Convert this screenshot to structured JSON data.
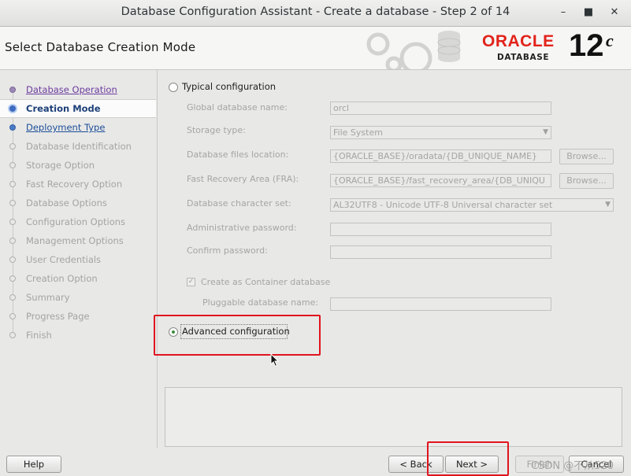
{
  "window": {
    "title": "Database Configuration Assistant - Create a database - Step 2 of 14"
  },
  "header": {
    "heading": "Select Database Creation Mode",
    "logo_brand": "ORACLE",
    "logo_product": "DATABASE",
    "logo_version": "12",
    "logo_version_suffix": "c"
  },
  "steps": [
    {
      "label": "Database Operation",
      "state": "done"
    },
    {
      "label": "Creation Mode",
      "state": "current"
    },
    {
      "label": "Deployment Type",
      "state": "link"
    },
    {
      "label": "Database Identification",
      "state": "disabled"
    },
    {
      "label": "Storage Option",
      "state": "disabled"
    },
    {
      "label": "Fast Recovery Option",
      "state": "disabled"
    },
    {
      "label": "Database Options",
      "state": "disabled"
    },
    {
      "label": "Configuration Options",
      "state": "disabled"
    },
    {
      "label": "Management Options",
      "state": "disabled"
    },
    {
      "label": "User Credentials",
      "state": "disabled"
    },
    {
      "label": "Creation Option",
      "state": "disabled"
    },
    {
      "label": "Summary",
      "state": "disabled"
    },
    {
      "label": "Progress Page",
      "state": "disabled"
    },
    {
      "label": "Finish",
      "state": "disabled"
    }
  ],
  "typical": {
    "label": "Typical configuration",
    "selected": false,
    "global_db_name_label": "Global database name:",
    "global_db_name_value": "orcl",
    "storage_type_label": "Storage type:",
    "storage_type_value": "File System",
    "db_files_location_label": "Database files location:",
    "db_files_location_value": "{ORACLE_BASE}/oradata/{DB_UNIQUE_NAME}",
    "fra_label": "Fast Recovery Area (FRA):",
    "fra_value": "{ORACLE_BASE}/fast_recovery_area/{DB_UNIQU",
    "charset_label": "Database character set:",
    "charset_value": "AL32UTF8 - Unicode UTF-8 Universal character set",
    "admin_password_label": "Administrative password:",
    "confirm_password_label": "Confirm password:",
    "browse_label": "Browse...",
    "container_db_label": "Create as Container database",
    "container_db_checked": true,
    "pluggable_db_label": "Pluggable database name:"
  },
  "advanced": {
    "label": "Advanced configuration",
    "selected": true
  },
  "buttons": {
    "help": "Help",
    "back": "< Back",
    "next": "Next >",
    "finish": "Finish",
    "cancel": "Cancel"
  },
  "watermark": "CSDN @不从520",
  "colors": {
    "oracle_red": "#e2231a",
    "highlight_red": "#e0141e"
  }
}
